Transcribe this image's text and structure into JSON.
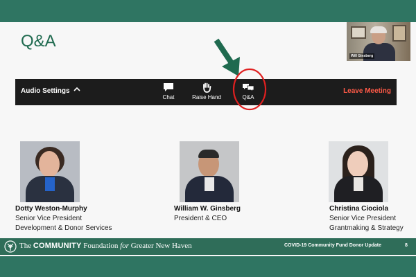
{
  "slide": {
    "title": "Q&A",
    "video_name": "Will Ginsberg"
  },
  "toolbar": {
    "audio_label": "Audio Settings",
    "chat_label": "Chat",
    "raise_hand_label": "Raise Hand",
    "qa_label": "Q&A",
    "leave_label": "Leave Meeting",
    "leave_color": "#ff5a47",
    "background": "#1c1c1c"
  },
  "annotation": {
    "arrow_color": "#1f6a4f",
    "circle_color": "#e02020"
  },
  "people": [
    {
      "name": "Dotty Weston-Murphy",
      "role_line1": "Senior Vice President",
      "role_line2": "Development & Donor Services"
    },
    {
      "name": "William W. Ginsberg",
      "role_line1": "President & CEO",
      "role_line2": ""
    },
    {
      "name": "Christina Ciociola",
      "role_line1": "Senior Vice President",
      "role_line2": "Grantmaking & Strategy"
    }
  ],
  "footer": {
    "brand_prefix": "The ",
    "brand_bold": "COMMUNITY",
    "brand_mid": " Foundation ",
    "brand_italic": "for",
    "brand_suffix": " Greater New Haven",
    "update_text": "COVID-19 Community Fund Donor Update",
    "page_number": "8",
    "color": "#2f6d59"
  }
}
